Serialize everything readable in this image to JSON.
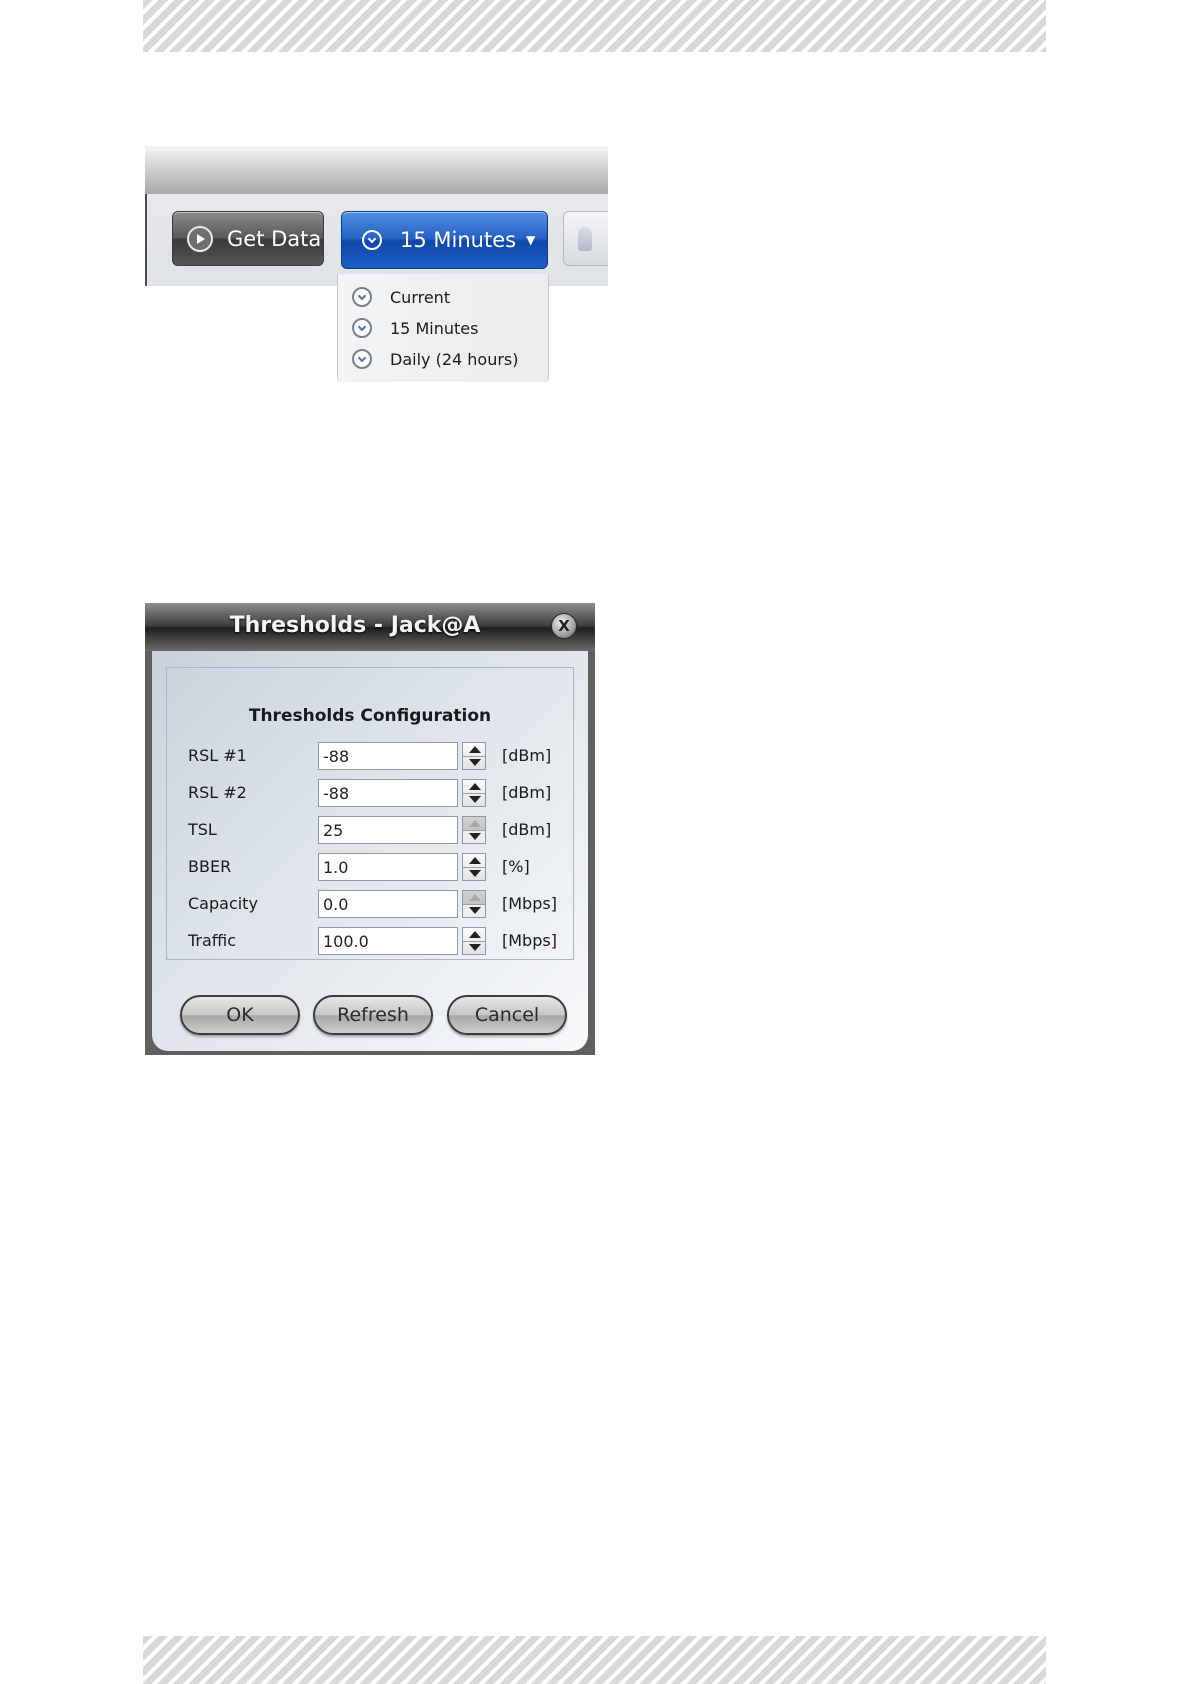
{
  "toolbar": {
    "get_data_label": "Get Data",
    "interval_label": "15 Minutes",
    "dropdown_items": [
      "Current",
      "15 Minutes",
      "Daily (24 hours)"
    ]
  },
  "dialog": {
    "title": "Thresholds - Jack@A",
    "close_glyph": "X",
    "group_title": "Thresholds Configuration",
    "rows": [
      {
        "label": "RSL #1",
        "value": "-88",
        "unit": "[dBm]"
      },
      {
        "label": "RSL #2",
        "value": "-88",
        "unit": "[dBm]"
      },
      {
        "label": "TSL",
        "value": "25",
        "unit": "[dBm]"
      },
      {
        "label": "BBER",
        "value": "1.0",
        "unit": "[%]"
      },
      {
        "label": "Capacity",
        "value": "0.0",
        "unit": "[Mbps]"
      },
      {
        "label": "Traffic",
        "value": "100.0",
        "unit": "[Mbps]"
      }
    ],
    "buttons": {
      "ok": "OK",
      "refresh": "Refresh",
      "cancel": "Cancel"
    }
  },
  "icons": {
    "play": "play-icon",
    "clock": "clock-icon",
    "close": "close-icon",
    "spin_up": "arrow-up-icon",
    "spin_down": "arrow-down-icon"
  },
  "colors": {
    "interval_button": "#1d5fc7",
    "dialog_chrome": "#3c3c3c"
  }
}
